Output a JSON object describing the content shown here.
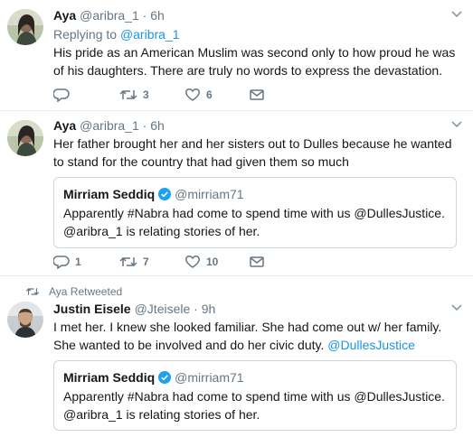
{
  "tweets": [
    {
      "name": "Aya",
      "handle": "@aribra_1",
      "dot": "·",
      "time": "6h",
      "replying_prefix": "Replying to",
      "replying_to": "@aribra_1",
      "text": "His pride as an American Muslim was second only to how proud he was of his daughters. There are truly no words to express the devastation.",
      "reply_count": "",
      "retweet_count": "3",
      "like_count": "6"
    },
    {
      "name": "Aya",
      "handle": "@aribra_1",
      "dot": "·",
      "time": "6h",
      "text": "Her father brought her and her sisters out to Dulles because he wanted to stand for the country that had given them so much",
      "quote": {
        "name": "Mirriam Seddiq",
        "handle": "@mirriam71",
        "text": "Apparently #Nabra had come to spend time with us @DullesJustice. @aribra_1 is relating stories of her."
      },
      "reply_count": "1",
      "retweet_count": "7",
      "like_count": "10"
    },
    {
      "retweeted_by": "Aya Retweeted",
      "name": "Justin Eisele",
      "handle": "@Jteisele",
      "dot": "·",
      "time": "9h",
      "text": "I met her. I knew she looked familiar. She had come out w/ her family. She wanted to be involved and do her civic duty.",
      "text_link": "@DullesJustice",
      "quote": {
        "name": "Mirriam Seddiq",
        "handle": "@mirriam71",
        "text": "Apparently #Nabra had come to spend time with us @DullesJustice. @aribra_1 is relating stories of her."
      }
    }
  ],
  "colors": {
    "accent": "#1b95e0",
    "muted": "#657786",
    "border": "#e6ecf0",
    "verified": "#1da1f2"
  },
  "icons": [
    "reply-icon",
    "retweet-icon",
    "like-icon",
    "message-icon",
    "chevron-down-icon",
    "verified-badge-icon"
  ]
}
